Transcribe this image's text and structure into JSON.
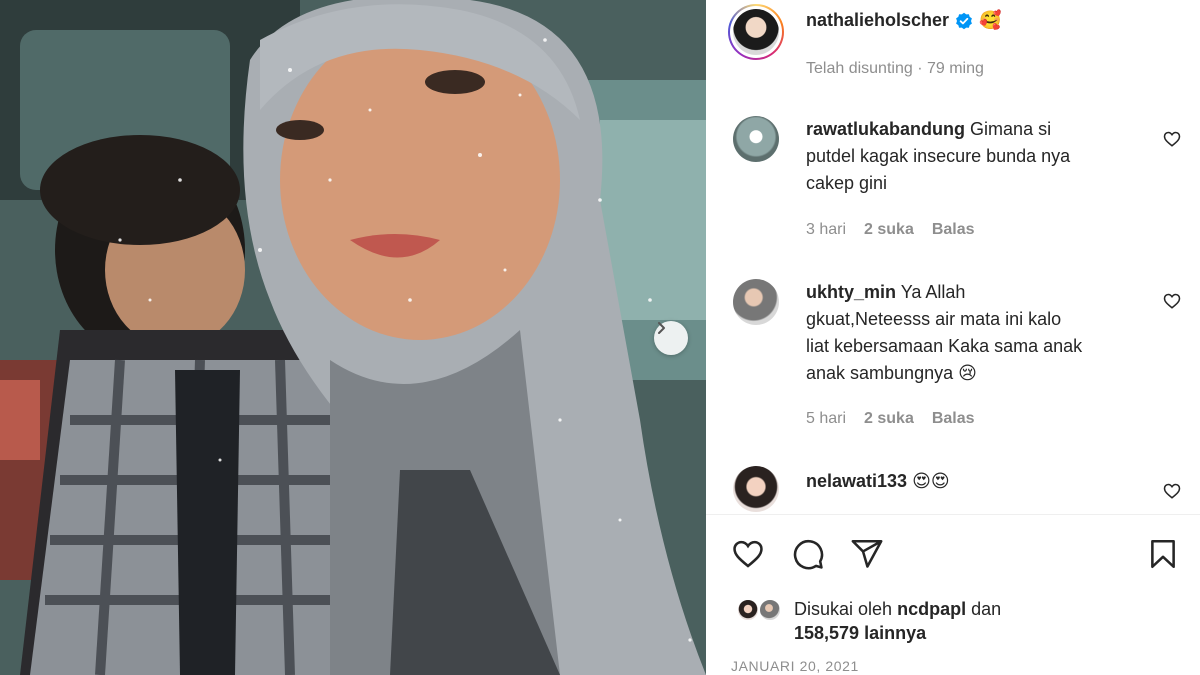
{
  "post": {
    "author": "nathalieholscher",
    "author_emoji": "🥰",
    "edited_label": "Telah disunting",
    "age": "79 ming",
    "date": "JANUARI 20, 2021"
  },
  "comments": [
    {
      "username": "rawatlukabandung",
      "text": "Gimana si putdel kagak insecure bunda nya cakep gini",
      "line1": "Gimana si",
      "line2": "putdel kagak insecure bunda nya",
      "line3": "cakep gini",
      "line4": "",
      "time": "3 hari",
      "likes": "2 suka",
      "reply": "Balas"
    },
    {
      "username": "ukhty_min",
      "text": "Ya Allah gkuat,Neteesss air mata ini kalo liat kebersamaan Kaka sama anak anak sambungnya 😢",
      "line1": "Ya Allah",
      "line2": "gkuat,Neteesss air mata ini kalo",
      "line3": "liat kebersamaan Kaka sama anak",
      "line4": "anak sambungnya 😢",
      "time": "5 hari",
      "likes": "2 suka",
      "reply": "Balas"
    },
    {
      "username": "nelawati133",
      "text": "😍😍",
      "line1": "😍😍"
    }
  ],
  "likes": {
    "prefix": "Disukai oleh",
    "user": "ncdpapl",
    "and": "dan",
    "count": "158,579 lainnya"
  },
  "icons": {
    "verified": "verified-badge-icon",
    "like": "heart-icon",
    "comment": "comment-bubble-icon",
    "share": "paper-plane-icon",
    "save": "bookmark-icon",
    "next": "chevron-right-icon"
  },
  "colors": {
    "verified_blue": "#0095f6",
    "text": "#262626",
    "muted": "#8e8e8e"
  }
}
